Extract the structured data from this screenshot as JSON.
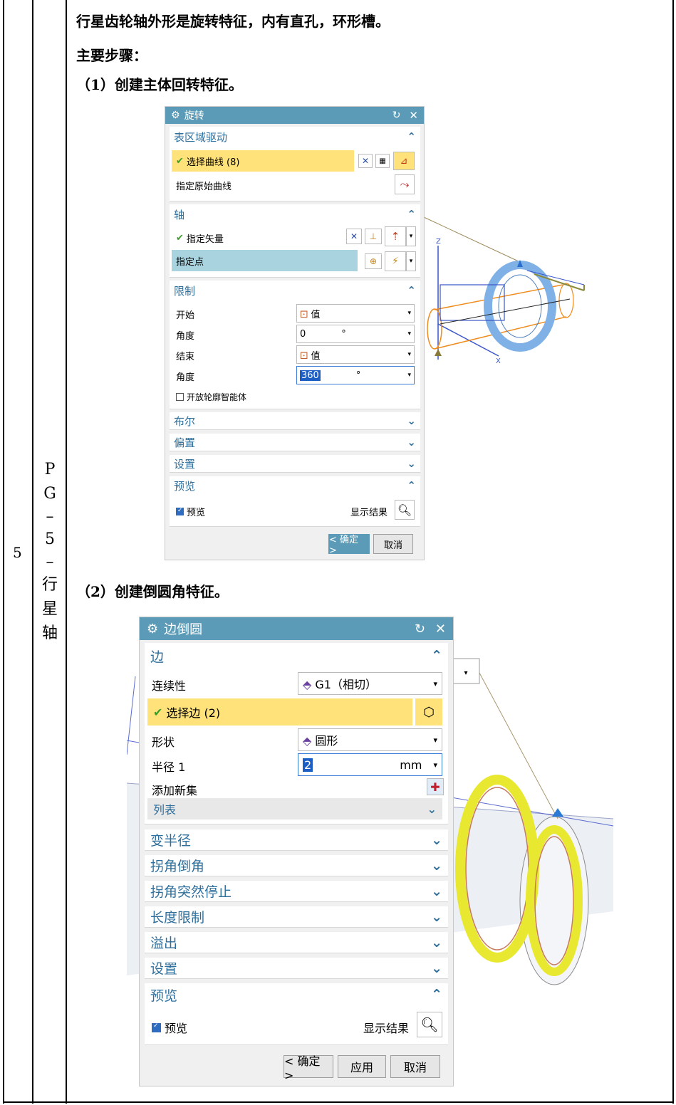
{
  "table": {
    "row_number": "5",
    "part_code_chars": [
      "P",
      "G",
      "–",
      "5",
      "–",
      "行",
      "星",
      "轴"
    ]
  },
  "content": {
    "intro": "行星齿轮轴外形是旋转特征，内有直孔，环形槽。",
    "steps_label": "主要步骤：",
    "step1": "（1）创建主体回转特征。",
    "step2": "（2）创建倒圆角特征。"
  },
  "dialog1": {
    "title": "旋转",
    "section_region": "表区域驱动",
    "select_curve": "选择曲线 (8)",
    "specify_orig_curve": "指定原始曲线",
    "section_axis": "轴",
    "specify_vector": "指定矢量",
    "specify_point": "指定点",
    "section_limit": "限制",
    "start_label": "开始",
    "start_value": "值",
    "angle1_label": "角度",
    "angle1_value": "0",
    "angle1_unit": "°",
    "end_label": "结束",
    "end_value": "值",
    "angle2_label": "角度",
    "angle2_value": "360",
    "angle2_unit": "°",
    "open_profile": "开放轮廓智能体",
    "section_bool": "布尔",
    "section_offset": "偏置",
    "section_settings": "设置",
    "section_preview": "预览",
    "preview_checkbox": "预览",
    "show_result": "显示结果",
    "ok": "< 确定 >",
    "cancel": "取消"
  },
  "dialog2": {
    "title": "边倒圆",
    "section_edge": "边",
    "continuity_label": "连续性",
    "continuity_value": "G1（相切）",
    "select_edge": "选择边 (2)",
    "shape_label": "形状",
    "shape_value": "圆形",
    "radius_label": "半径 1",
    "radius_value": "2",
    "radius_unit": "mm",
    "add_new_set": "添加新集",
    "list": "列表",
    "sections": [
      "变半径",
      "拐角倒角",
      "拐角突然停止",
      "长度限制",
      "溢出",
      "设置"
    ],
    "section_preview": "预览",
    "preview_checkbox": "预览",
    "show_result": "显示结果",
    "ok": "< 确定 >",
    "apply": "应用",
    "cancel": "取消"
  },
  "viewport1": {
    "axis_z": "Z",
    "axis_x": "X"
  },
  "colors": {
    "title_bar": "#5b9bb7",
    "section_header": "#2f6f9c",
    "highlight_yellow": "#ffe27a",
    "highlight_blue": "#a9d3df",
    "check": "#3b9d28"
  }
}
